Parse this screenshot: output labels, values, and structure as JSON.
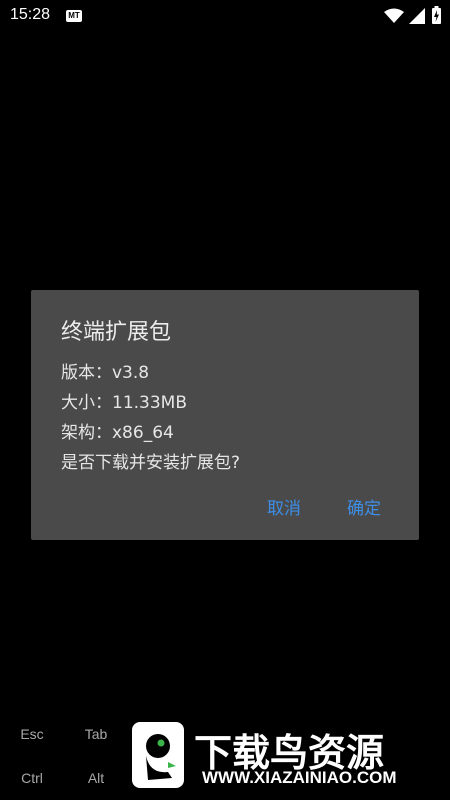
{
  "status_bar": {
    "time": "15:28",
    "app_badge": "MT",
    "icons": [
      "wifi-icon",
      "signal-icon",
      "battery-charging-icon"
    ]
  },
  "dialog": {
    "title": "终端扩展包",
    "lines": [
      "版本：v3.8",
      "大小：11.33MB",
      "架构：x86_64",
      "是否下载并安装扩展包?"
    ],
    "cancel_label": "取消",
    "ok_label": "确定",
    "button_color": "#3d8ee6",
    "background_color": "#4a4a4a"
  },
  "extra_keys": {
    "row1": [
      "Esc",
      "Tab"
    ],
    "row2": [
      "Ctrl",
      "Alt"
    ]
  },
  "watermark": {
    "title": "下载鸟资源",
    "url": "WWW.XIAZAINIAO.COM",
    "accent_color": "#3bb54a"
  }
}
